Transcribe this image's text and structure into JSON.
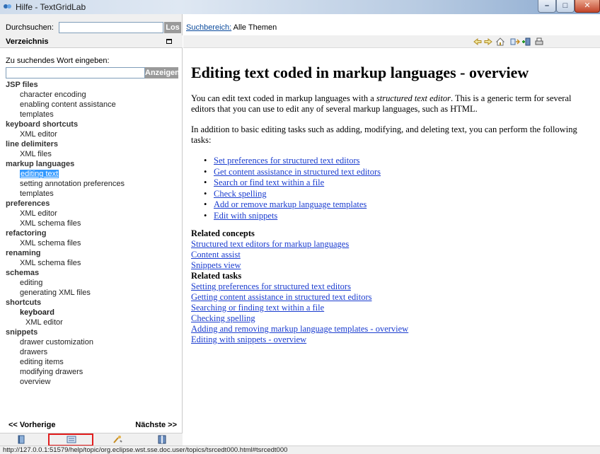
{
  "window": {
    "title": "Hilfe - TextGridLab",
    "controls": [
      "minimize",
      "maximize",
      "close"
    ]
  },
  "search": {
    "label": "Durchsuchen:",
    "value": "",
    "go_label": "Los",
    "scope_link": "Suchbereich:",
    "scope_value": "Alle Themen"
  },
  "sidebar": {
    "header": "Verzeichnis",
    "prompt": "Zu suchendes Wort eingeben:",
    "word_value": "",
    "show_label": "Anzeigen",
    "index": [
      {
        "text": "JSP files",
        "level": "h"
      },
      {
        "text": "character encoding",
        "level": "s"
      },
      {
        "text": "enabling content assistance",
        "level": "s"
      },
      {
        "text": "templates",
        "level": "s"
      },
      {
        "text": "keyboard shortcuts",
        "level": "h"
      },
      {
        "text": "XML editor",
        "level": "s"
      },
      {
        "text": "line delimiters",
        "level": "h"
      },
      {
        "text": "XML files",
        "level": "s"
      },
      {
        "text": "markup languages",
        "level": "h"
      },
      {
        "text": "editing text",
        "level": "s",
        "selected": true
      },
      {
        "text": "setting annotation preferences",
        "level": "s"
      },
      {
        "text": "templates",
        "level": "s"
      },
      {
        "text": "preferences",
        "level": "h"
      },
      {
        "text": "XML editor",
        "level": "s"
      },
      {
        "text": "XML schema files",
        "level": "s"
      },
      {
        "text": "refactoring",
        "level": "h"
      },
      {
        "text": "XML schema files",
        "level": "s"
      },
      {
        "text": "renaming",
        "level": "h"
      },
      {
        "text": "XML schema files",
        "level": "s"
      },
      {
        "text": "schemas",
        "level": "h"
      },
      {
        "text": "editing",
        "level": "s"
      },
      {
        "text": "generating XML files",
        "level": "s"
      },
      {
        "text": "shortcuts",
        "level": "h"
      },
      {
        "text": "keyboard",
        "level": "s",
        "bold": true
      },
      {
        "text": "XML editor",
        "level": "s2"
      },
      {
        "text": "snippets",
        "level": "h"
      },
      {
        "text": "drawer customization",
        "level": "s"
      },
      {
        "text": "drawers",
        "level": "s"
      },
      {
        "text": "editing items",
        "level": "s"
      },
      {
        "text": "modifying drawers",
        "level": "s"
      },
      {
        "text": "overview",
        "level": "s"
      }
    ],
    "prev_label": "<< Vorherige",
    "next_label": "Nächste >>",
    "tabs": [
      "contents-icon",
      "index-icon",
      "search-results-icon",
      "bookmarks-icon"
    ],
    "active_tab": "index-icon"
  },
  "toolbar": {
    "icons": [
      "back-icon",
      "forward-icon",
      "home-icon",
      "sync-toc-icon",
      "bookmark-add-icon",
      "print-icon"
    ]
  },
  "article": {
    "title": "Editing text coded in markup languages - overview",
    "intro_prefix": "You can edit text coded in markup languages with a ",
    "intro_em": "structured text editor",
    "intro_suffix": ". This is a generic term for several",
    "intro_line2": "editors that you can use to edit any of several markup languages, such as HTML.",
    "tasks_line1": "In addition to basic editing tasks such as adding, modifying, and deleting text, you can perform the following",
    "tasks_line2": "tasks:",
    "task_links": [
      "Set preferences for structured text editors",
      "Get content assistance in structured text editors",
      "Search or find text within a file",
      "Check spelling",
      "Add or remove markup language templates",
      "Edit with snippets"
    ],
    "related_concepts_heading": "Related concepts",
    "related_concepts": [
      "Structured text editors for markup languages",
      "Content assist",
      "Snippets view"
    ],
    "related_tasks_heading": "Related tasks",
    "related_tasks": [
      "Setting preferences for structured text editors",
      "Getting content assistance in structured text editors",
      "Searching or finding text within a file",
      "Checking spelling",
      "Adding and removing markup language templates - overview",
      "Editing with snippets - overview"
    ]
  },
  "status": {
    "url": "http://127.0.0.1:51579/help/topic/org.eclipse.wst.sse.doc.user/topics/tsrcedt000.html#tsrcedt000"
  },
  "colors": {
    "link": "#1a3ccf",
    "selection": "#3399ff",
    "highlight_box": "#e21d1d",
    "button_gray": "#9a9a9a"
  }
}
